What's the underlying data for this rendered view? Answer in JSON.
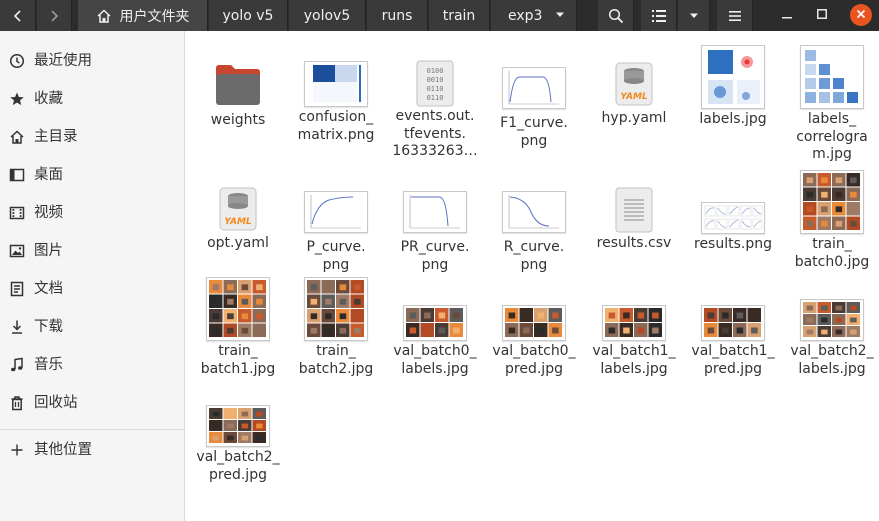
{
  "breadcrumb": {
    "home_label": "用户文件夹",
    "segments": [
      "yolo v5",
      "yolov5",
      "runs",
      "train",
      "exp3"
    ]
  },
  "sidebar": {
    "items": [
      {
        "label": "最近使用",
        "icon": "clock-icon"
      },
      {
        "label": "收藏",
        "icon": "star-icon"
      },
      {
        "label": "主目录",
        "icon": "home-icon"
      },
      {
        "label": "桌面",
        "icon": "desktop-icon"
      },
      {
        "label": "视频",
        "icon": "video-icon"
      },
      {
        "label": "图片",
        "icon": "picture-icon"
      },
      {
        "label": "文档",
        "icon": "document-icon"
      },
      {
        "label": "下载",
        "icon": "download-icon"
      },
      {
        "label": "音乐",
        "icon": "music-icon"
      },
      {
        "label": "回收站",
        "icon": "trash-icon"
      }
    ],
    "other_locations": {
      "label": "其他位置",
      "icon": "plus-icon"
    }
  },
  "files": [
    {
      "name": "weights",
      "type": "folder"
    },
    {
      "name": "confusion_\nmatrix.png",
      "type": "png-matrix"
    },
    {
      "name": "events.out.\ntfevents.\n16333263…",
      "type": "binary"
    },
    {
      "name": "F1_curve.\npng",
      "type": "png-curve"
    },
    {
      "name": "hyp.yaml",
      "type": "yaml"
    },
    {
      "name": "labels.jpg",
      "type": "png-labels"
    },
    {
      "name": "labels_\ncorrelogra\nm.jpg",
      "type": "png-correlogram"
    },
    {
      "name": "opt.yaml",
      "type": "yaml"
    },
    {
      "name": "P_curve.\npng",
      "type": "png-curve"
    },
    {
      "name": "PR_curve.\npng",
      "type": "png-curve"
    },
    {
      "name": "R_curve.\npng",
      "type": "png-curve"
    },
    {
      "name": "results.csv",
      "type": "csv"
    },
    {
      "name": "results.png",
      "type": "png-results"
    },
    {
      "name": "train_\nbatch0.jpg",
      "type": "jpg-batch"
    },
    {
      "name": "train_\nbatch1.jpg",
      "type": "jpg-batch"
    },
    {
      "name": "train_\nbatch2.jpg",
      "type": "jpg-batch"
    },
    {
      "name": "val_batch0_\nlabels.jpg",
      "type": "jpg-batch"
    },
    {
      "name": "val_batch0_\npred.jpg",
      "type": "jpg-batch"
    },
    {
      "name": "val_batch1_\nlabels.jpg",
      "type": "jpg-batch"
    },
    {
      "name": "val_batch1_\npred.jpg",
      "type": "jpg-batch"
    },
    {
      "name": "val_batch2_\nlabels.jpg",
      "type": "jpg-batch"
    },
    {
      "name": "val_batch2_\npred.jpg",
      "type": "jpg-batch"
    }
  ],
  "colors": {
    "header_bg": "#2c2c2c",
    "close_button": "#e95420",
    "folder": "#6b6b6b",
    "folder_tab": "#c7462f",
    "yaml": "#f08a1c"
  }
}
